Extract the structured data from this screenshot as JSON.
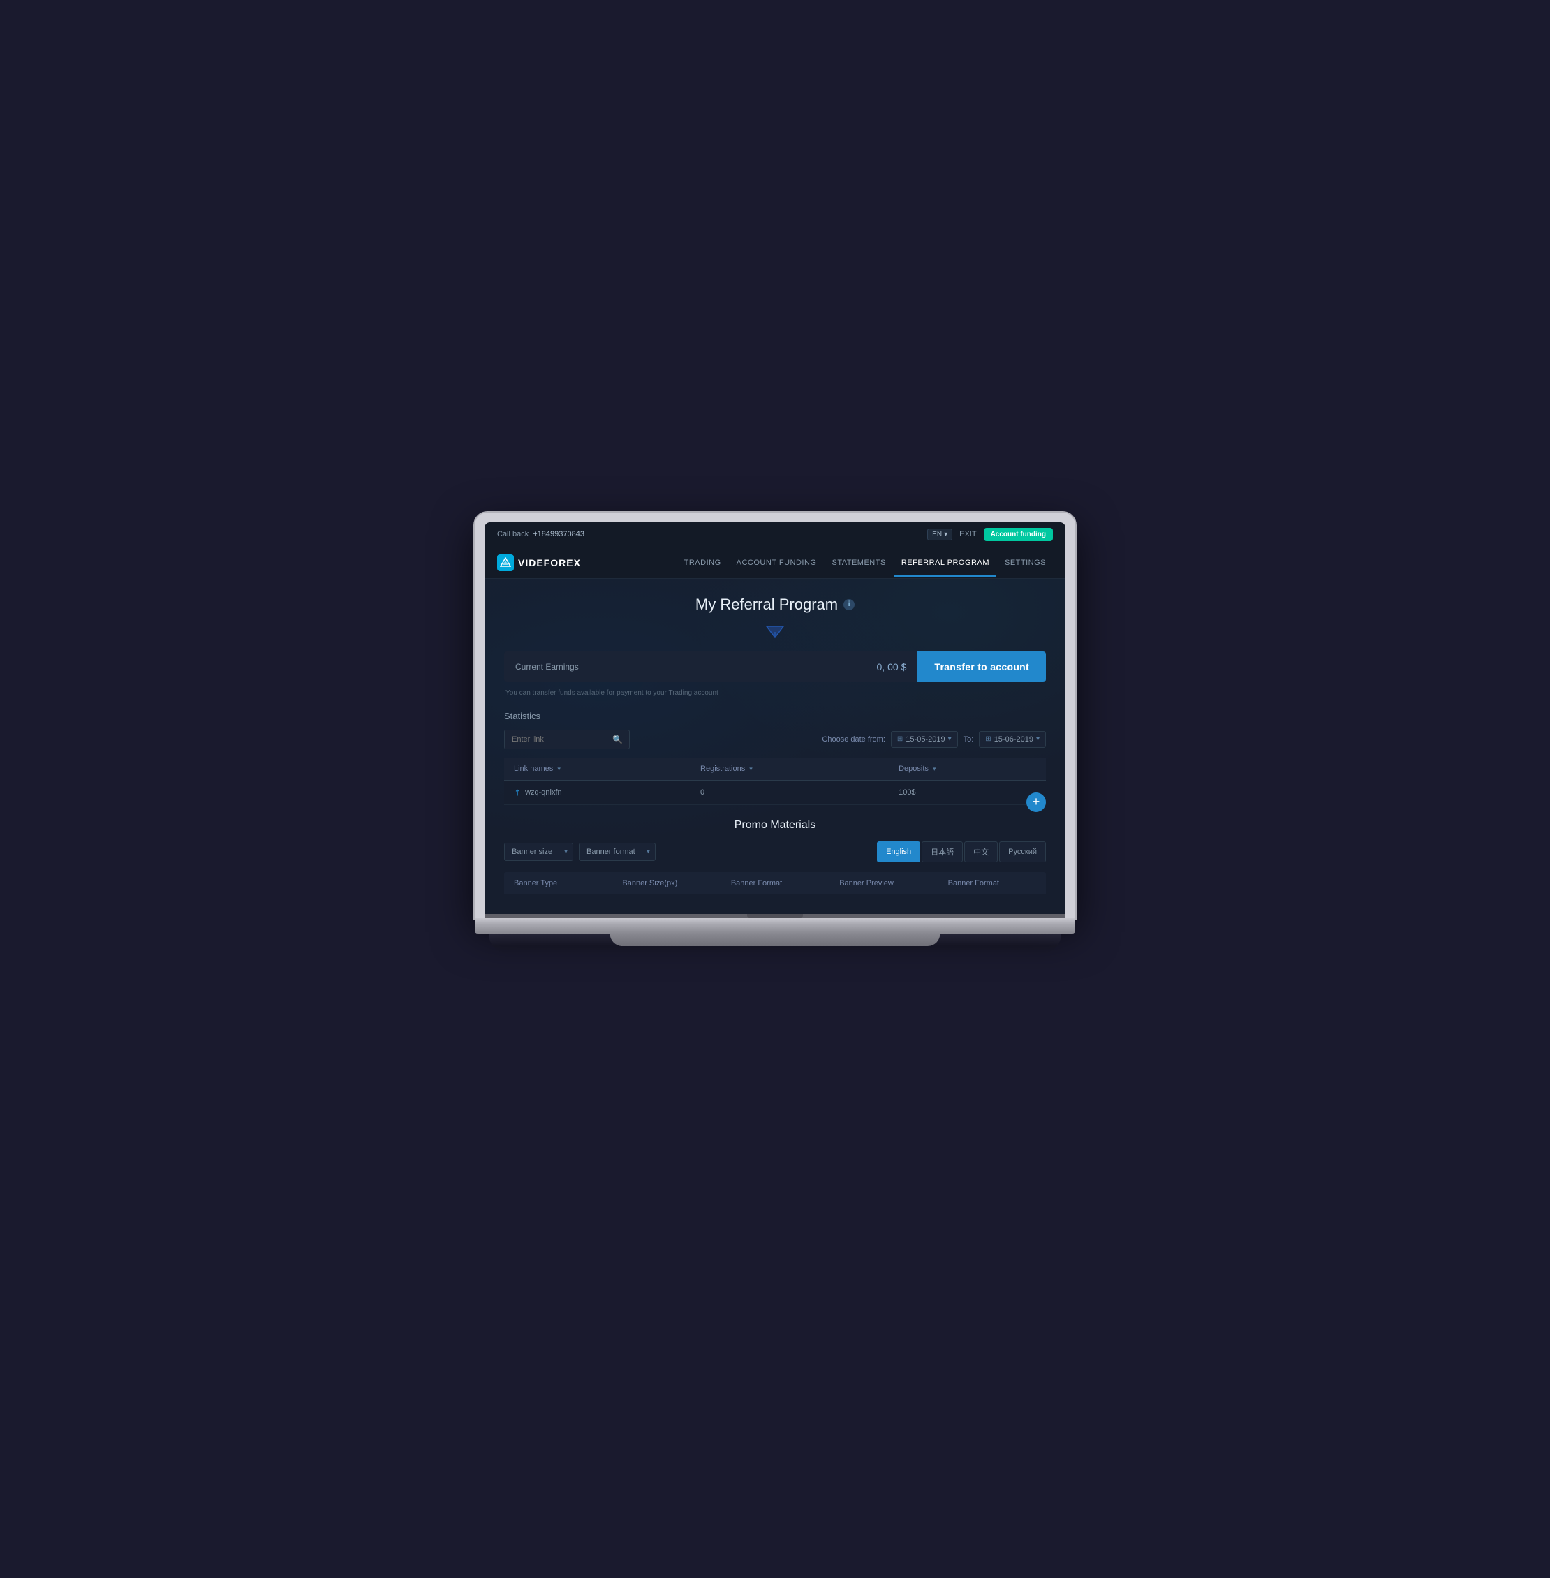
{
  "topbar": {
    "call_back_label": "Call back",
    "phone": "+18499370843",
    "lang": "EN",
    "lang_dropdown": "▾",
    "exit_label": "EXIT",
    "account_funding_btn": "Account funding"
  },
  "navbar": {
    "logo_text": "VIDEFOREX",
    "links": [
      {
        "label": "TRADING"
      },
      {
        "label": "ACCOUNT FUNDING"
      },
      {
        "label": "STATEMENTS"
      },
      {
        "label": "REFERRAL PROGRAM"
      },
      {
        "label": "SETTINGS"
      }
    ]
  },
  "page": {
    "title": "My Referral Program",
    "info_icon": "i",
    "earnings": {
      "label": "Current Earnings",
      "amount": "0, 00 $",
      "transfer_btn": "Transfer to account",
      "note": "You can transfer funds available for payment to your Trading account"
    },
    "statistics": {
      "section_label": "Statistics",
      "search_placeholder": "Enter link",
      "date_from_label": "Choose date from:",
      "date_from": "15-05-2019",
      "date_to_label": "To:",
      "date_to": "15-06-2019",
      "table": {
        "headers": [
          {
            "label": "Link names",
            "sort": "▾"
          },
          {
            "label": "Registrations",
            "sort": "▾"
          },
          {
            "label": "Deposits",
            "sort": "▾"
          }
        ],
        "rows": [
          {
            "link": "wzq-qnlxfn",
            "registrations": "0",
            "deposits": "100$"
          }
        ]
      },
      "add_btn": "+"
    },
    "promo": {
      "title": "Promo Materials",
      "banner_size_label": "Banner size",
      "banner_format_label": "Banner format",
      "lang_tabs": [
        {
          "label": "English",
          "active": true
        },
        {
          "label": "日本語",
          "active": false
        },
        {
          "label": "中文",
          "active": false
        },
        {
          "label": "Русский",
          "active": false
        }
      ],
      "table_headers": [
        {
          "label": "Banner Type"
        },
        {
          "label": "Banner Size(px)"
        },
        {
          "label": "Banner Format"
        },
        {
          "label": "Banner Preview"
        },
        {
          "label": "Banner Format"
        }
      ]
    }
  }
}
